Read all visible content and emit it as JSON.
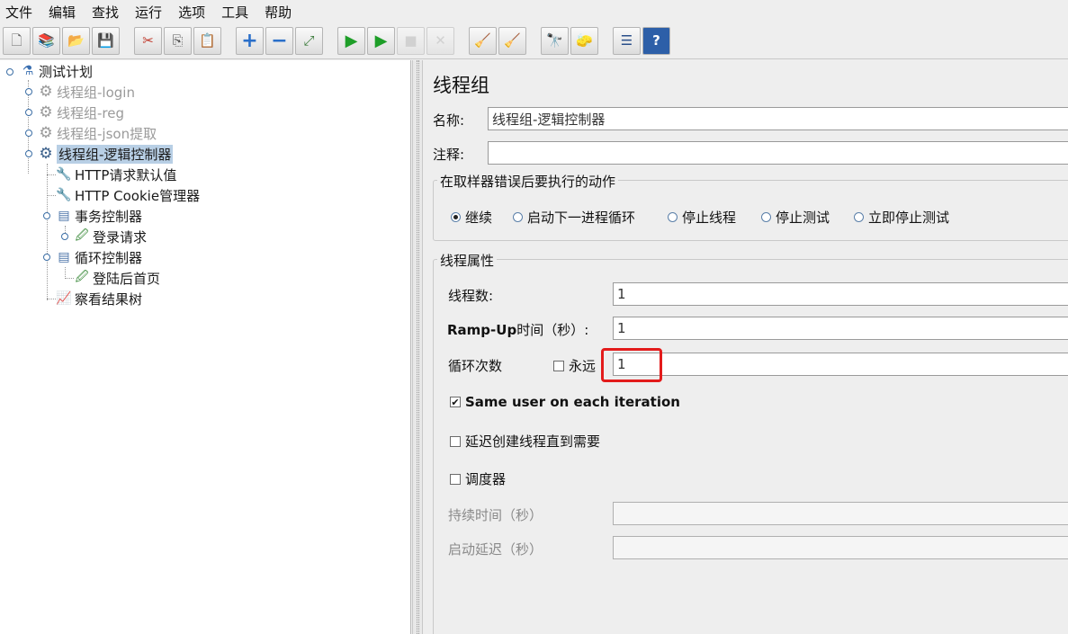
{
  "menu": [
    "文件",
    "编辑",
    "查找",
    "运行",
    "选项",
    "工具",
    "帮助"
  ],
  "toolbar": {
    "buttons": [
      {
        "name": "new-icon",
        "glyph": "🗋"
      },
      {
        "name": "templates-icon",
        "glyph": "📚"
      },
      {
        "name": "open-icon",
        "glyph": "📂"
      },
      {
        "name": "save-icon",
        "glyph": "💾"
      },
      {
        "name": "cut-icon",
        "glyph": "✂"
      },
      {
        "name": "copy-icon",
        "glyph": "⎘"
      },
      {
        "name": "paste-icon",
        "glyph": "📋"
      },
      {
        "name": "expand-icon",
        "glyph": "+"
      },
      {
        "name": "collapse-icon",
        "glyph": "−"
      },
      {
        "name": "toggle-icon",
        "glyph": "⤢"
      },
      {
        "name": "start-icon",
        "glyph": "▶"
      },
      {
        "name": "start-no-pause-icon",
        "glyph": "▶"
      },
      {
        "name": "stop-icon",
        "glyph": "■"
      },
      {
        "name": "shutdown-icon",
        "glyph": "✕"
      },
      {
        "name": "clear-icon",
        "glyph": "🧹"
      },
      {
        "name": "clear-all-icon",
        "glyph": "🧹"
      },
      {
        "name": "search-icon",
        "glyph": "🔭"
      },
      {
        "name": "reset-search-icon",
        "glyph": "🧽"
      },
      {
        "name": "function-helper-icon",
        "glyph": "☰"
      },
      {
        "name": "help-icon",
        "glyph": "?"
      }
    ]
  },
  "tree": {
    "items": [
      {
        "label": "测试计划",
        "icon": "flask-icon",
        "glyph": "⚗",
        "state": "normal"
      },
      {
        "label": "线程组-login",
        "icon": "gear-icon",
        "glyph": "⚙",
        "state": "disabled"
      },
      {
        "label": "线程组-reg",
        "icon": "gear-icon",
        "glyph": "⚙",
        "state": "disabled"
      },
      {
        "label": "线程组-json提取",
        "icon": "gear-icon",
        "glyph": "⚙",
        "state": "disabled"
      },
      {
        "label": "线程组-逻辑控制器",
        "icon": "gear-icon",
        "glyph": "⚙",
        "state": "selected"
      },
      {
        "label": "HTTP请求默认值",
        "icon": "wrench-icon",
        "glyph": "🔧",
        "state": "normal"
      },
      {
        "label": "HTTP Cookie管理器",
        "icon": "wrench-icon",
        "glyph": "🔧",
        "state": "normal"
      },
      {
        "label": "事务控制器",
        "icon": "controller-icon",
        "glyph": "▤",
        "state": "normal"
      },
      {
        "label": "登录请求",
        "icon": "sampler-icon",
        "glyph": "🖉",
        "state": "normal"
      },
      {
        "label": "循环控制器",
        "icon": "controller-icon",
        "glyph": "▤",
        "state": "normal"
      },
      {
        "label": "登陆后首页",
        "icon": "sampler-icon",
        "glyph": "🖉",
        "state": "normal"
      },
      {
        "label": "察看结果树",
        "icon": "listener-icon",
        "glyph": "📈",
        "state": "normal"
      }
    ]
  },
  "panel": {
    "title": "线程组",
    "name_label": "名称:",
    "name_value": "线程组-逻辑控制器",
    "comment_label": "注释:",
    "comment_value": "",
    "error_action": {
      "title": "在取样器错误后要执行的动作",
      "options": [
        "继续",
        "启动下一进程循环",
        "停止线程",
        "停止测试",
        "立即停止测试"
      ],
      "selected": "继续"
    },
    "thread_props": {
      "title": "线程属性",
      "threads_label": "线程数:",
      "threads_value": "1",
      "rampup_label_en": "Ramp-Up",
      "rampup_label_cn": "时间（秒）:",
      "rampup_value": "1",
      "loop_label": "循环次数",
      "forever_label": "永远",
      "forever_checked": false,
      "loop_value": "1",
      "same_user_label": "Same user on each iteration",
      "same_user_checked": true,
      "delay_label": "延迟创建线程直到需要",
      "delay_checked": false,
      "scheduler_label": "调度器",
      "scheduler_checked": false,
      "duration_label": "持续时间（秒）",
      "duration_value": "",
      "startup_delay_label": "启动延迟（秒）",
      "startup_delay_value": ""
    }
  },
  "colors": {
    "highlight": "#e31b1b",
    "selection": "#b8cfe5",
    "disabled_text": "#9a9a9a"
  }
}
